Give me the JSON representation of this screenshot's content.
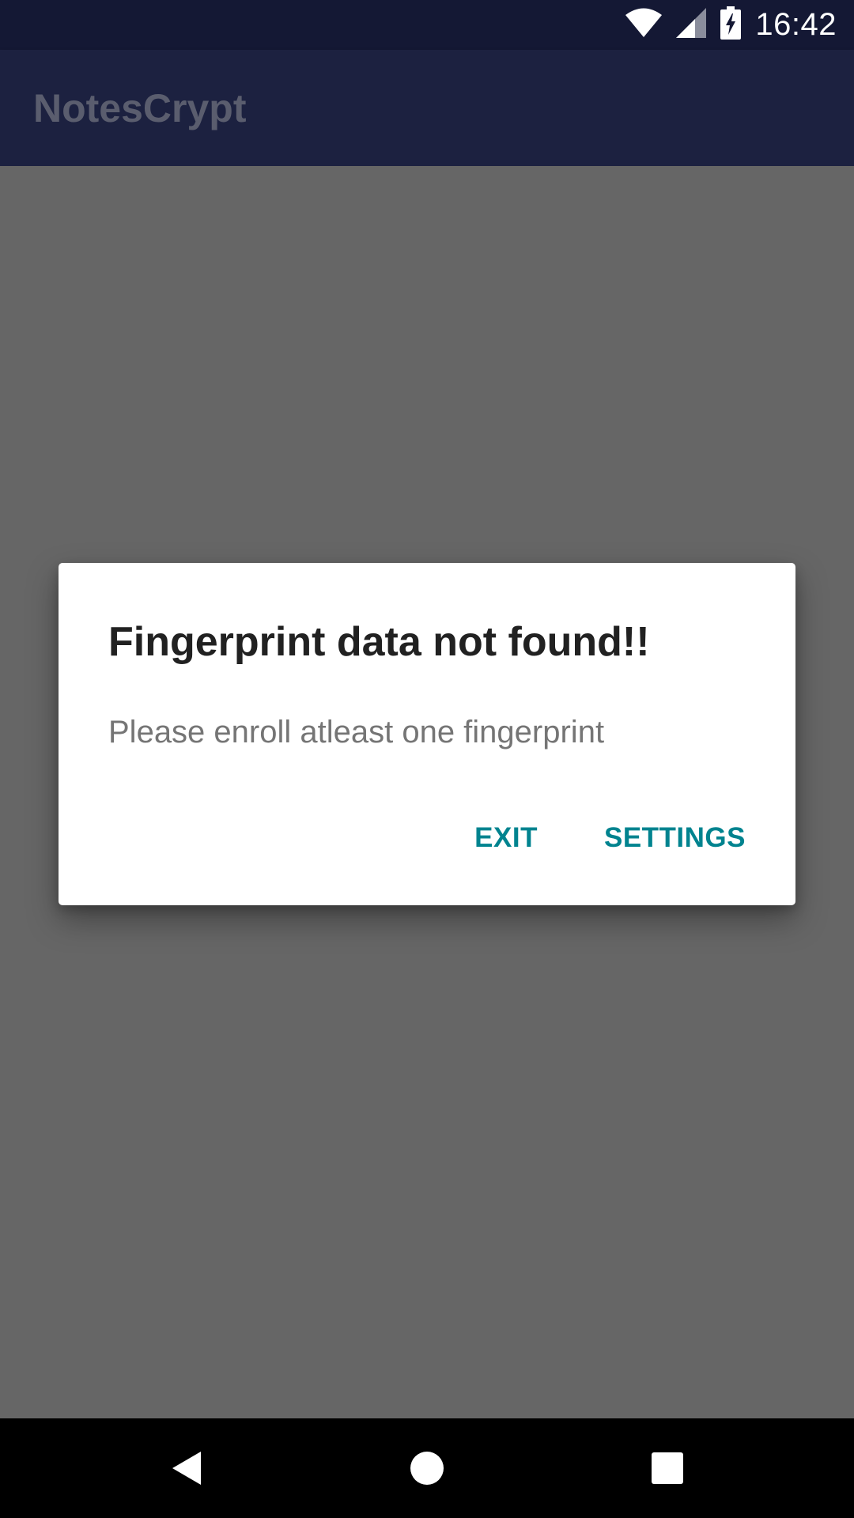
{
  "status_bar": {
    "time": "16:42",
    "icons": [
      "wifi-icon",
      "signal-icon",
      "battery-charging-icon"
    ]
  },
  "app_bar": {
    "title": "NotesCrypt"
  },
  "dialog": {
    "title": "Fingerprint data not found!!",
    "message": "Please enroll atleast one fingerprint",
    "buttons": {
      "exit": "EXIT",
      "settings": "SETTINGS"
    },
    "accent_color": "#00838f"
  },
  "nav_bar": {
    "icons": [
      "back-icon",
      "home-icon",
      "recents-icon"
    ]
  },
  "colors": {
    "status_bar": "#141834",
    "app_bar": "#1c2140",
    "scrim": "#666666"
  }
}
